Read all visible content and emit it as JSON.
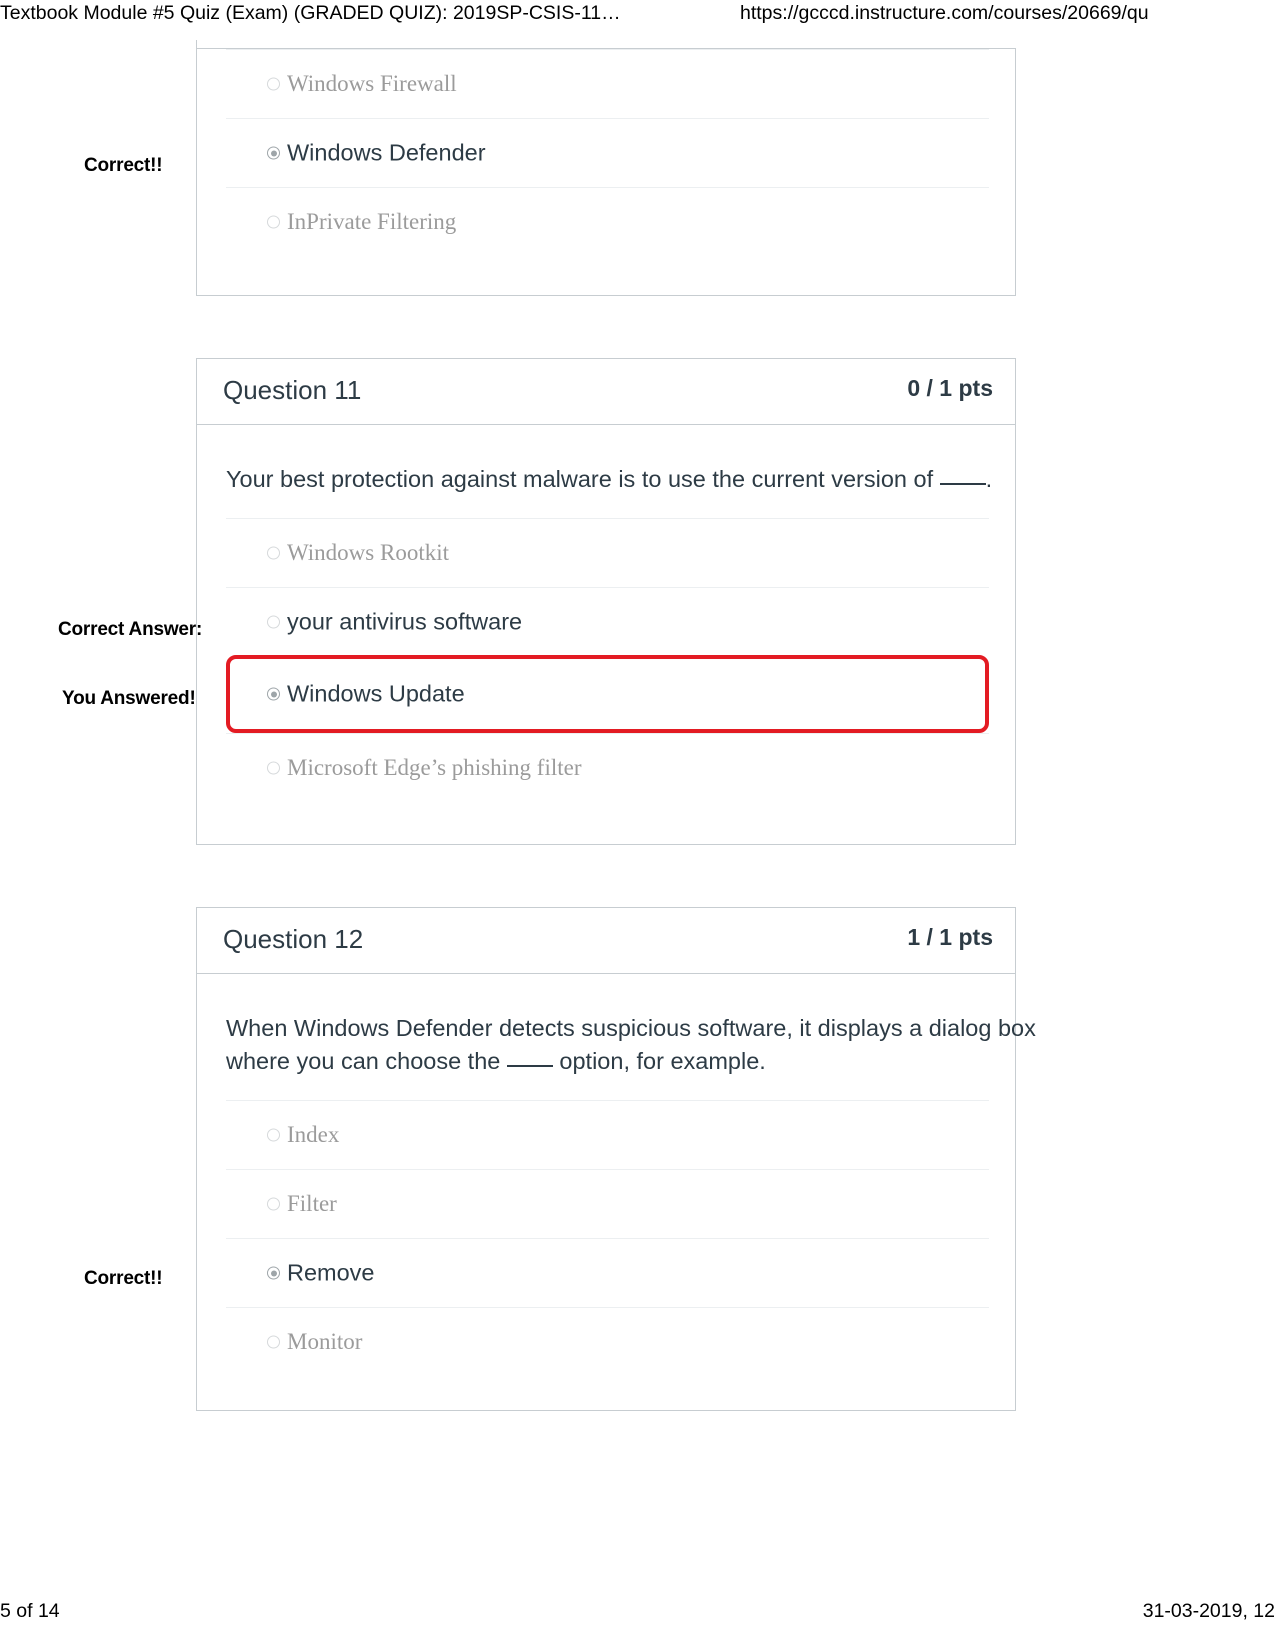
{
  "print_header": {
    "title": "Textbook Module #5 Quiz (Exam) (GRADED QUIZ): 2019SP-CSIS-11…",
    "url": "https://gcccd.instructure.com/courses/20669/qu"
  },
  "print_footer": {
    "page": "5 of 14",
    "date": "31-03-2019, 12"
  },
  "annotations": {
    "correct": "Correct!!",
    "correct_answer": "Correct Answer:",
    "you_answered": "You Answered!"
  },
  "questions": [
    {
      "name": "",
      "points": "",
      "text": "",
      "answers": [
        {
          "label": "Windows Firewall",
          "selected": false,
          "highlight": false
        },
        {
          "label": "Windows Defender",
          "selected": true,
          "highlight": false
        },
        {
          "label": "InPrivate Filtering",
          "selected": false,
          "highlight": false
        }
      ]
    },
    {
      "name": "Question 11",
      "points": "0 / 1 pts",
      "text_pre": "Your best protection against malware is to use the current version of ",
      "text_post": ".",
      "answers": [
        {
          "label": "Windows Rootkit",
          "selected": false,
          "highlight": false
        },
        {
          "label": "your antivirus software",
          "selected": false,
          "highlight": false
        },
        {
          "label": "Windows Update",
          "selected": true,
          "highlight": true
        },
        {
          "label": "Microsoft Edge’s phishing filter",
          "selected": false,
          "highlight": false
        }
      ]
    },
    {
      "name": "Question 12",
      "points": "1 / 1 pts",
      "text_pre": "When Windows Defender detects suspicious software, it displays a dialog box where you can choose the ",
      "text_post": " option, for example.",
      "answers": [
        {
          "label": "Index",
          "selected": false,
          "highlight": false
        },
        {
          "label": "Filter",
          "selected": false,
          "highlight": false
        },
        {
          "label": "Remove",
          "selected": true,
          "highlight": false
        },
        {
          "label": "Monitor",
          "selected": false,
          "highlight": false
        }
      ]
    }
  ],
  "colors": {
    "highlight_red": "#e31b23",
    "border_gray": "#c7cdd1",
    "text_dark": "#2d3b45",
    "text_muted": "#9b9b9b"
  }
}
